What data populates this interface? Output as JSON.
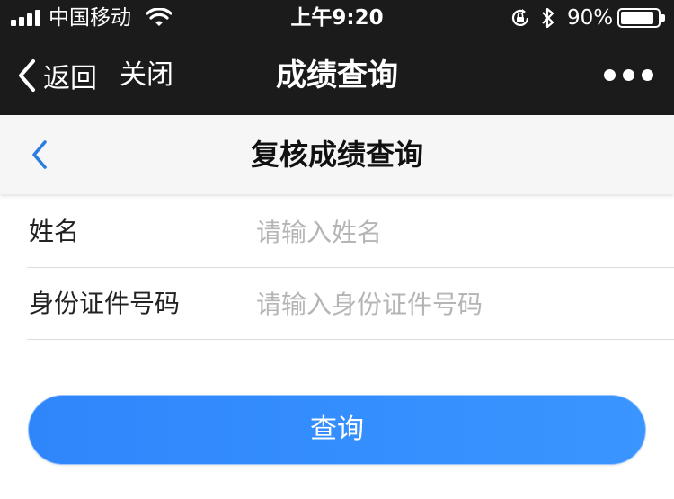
{
  "status_bar": {
    "carrier": "中国移动",
    "time": "上午9:20",
    "battery_percent": "90%",
    "battery_level": 0.9,
    "icons": [
      "signal-icon",
      "wifi-icon",
      "rotation-lock-icon",
      "bluetooth-icon",
      "battery-icon"
    ]
  },
  "wechat_nav": {
    "back_label": "返回",
    "close_label": "关闭",
    "title": "成绩查询"
  },
  "page_header": {
    "title": "复核成绩查询"
  },
  "form": {
    "fields": [
      {
        "label": "姓名",
        "placeholder": "请输入姓名",
        "value": ""
      },
      {
        "label": "身份证件号码",
        "placeholder": "请输入身份证件号码",
        "value": ""
      }
    ]
  },
  "submit": {
    "label": "查询"
  },
  "colors": {
    "nav_background": "#1b1b1c",
    "header_background": "#f6f6f6",
    "accent_blue": "#2f86fb",
    "back_chevron": "#2a7de1",
    "placeholder": "#b5b5b5"
  }
}
